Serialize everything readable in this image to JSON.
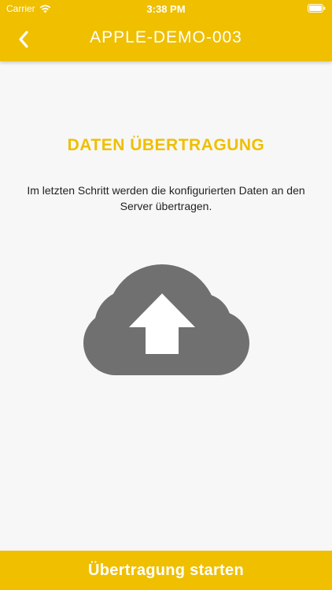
{
  "status_bar": {
    "carrier": "Carrier",
    "time": "3:38 PM",
    "wifi_icon": "wifi-icon",
    "battery_icon": "battery-icon"
  },
  "nav": {
    "back_icon": "chevron-left-icon",
    "title": "APPLE-DEMO-003"
  },
  "main": {
    "title": "DATEN ÜBERTRAGUNG",
    "description": "Im letzten Schritt werden die konfigurierten Daten an den Server übertragen.",
    "illustration_icon": "cloud-upload-icon"
  },
  "footer": {
    "start_label": "Übertragung starten"
  },
  "colors": {
    "accent": "#efbf00",
    "background": "#f7f7f7",
    "icon_gray": "#707070",
    "text_dark": "#222222",
    "white": "#ffffff"
  }
}
